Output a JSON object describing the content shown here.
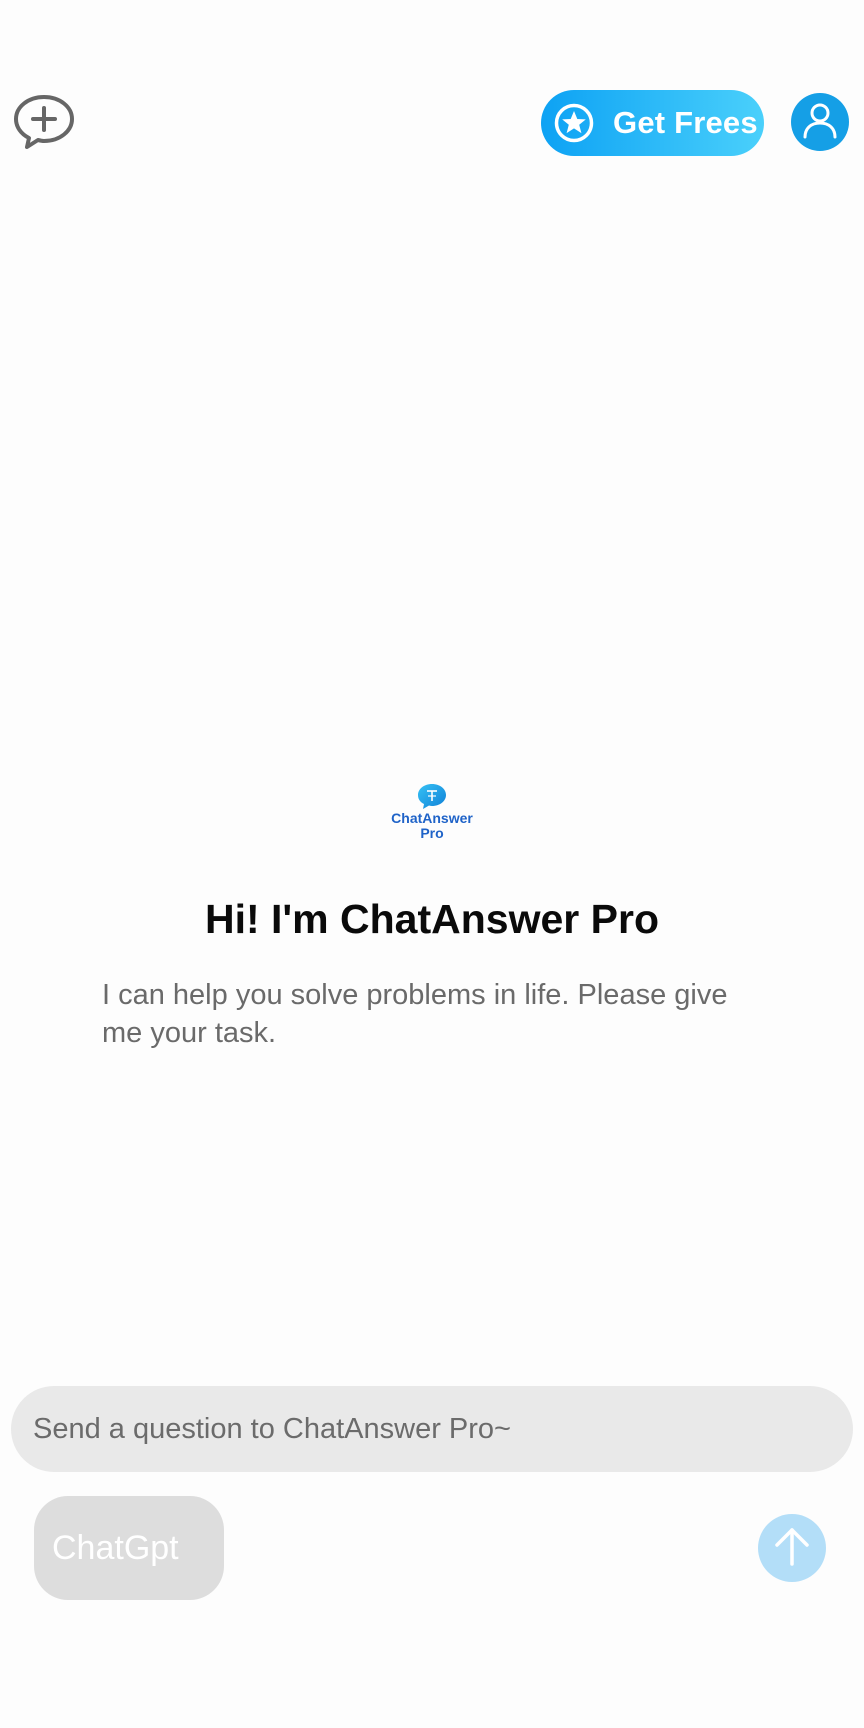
{
  "header": {
    "get_frees_label": "Get Frees",
    "icons": {
      "new_chat": "chat-plus-icon",
      "star": "star-circle-icon",
      "profile": "user-icon"
    }
  },
  "welcome": {
    "logo_text_line1": "ChatAnswer",
    "logo_text_line2": "Pro",
    "title": "Hi! I'm ChatAnswer Pro",
    "subtitle": "I can help you solve problems in life. Please give me your task."
  },
  "composer": {
    "placeholder": "Send a question to ChatAnswer Pro~",
    "value": "",
    "model_label": "ChatGpt",
    "send_icon": "arrow-up-icon"
  },
  "colors": {
    "accent_gradient_start": "#0da2f4",
    "accent_gradient_end": "#4ad0fb",
    "profile_bg": "#159fe6",
    "send_bg": "#b3def8",
    "input_bg": "#e9e9e9",
    "model_bg": "#dddddd"
  }
}
